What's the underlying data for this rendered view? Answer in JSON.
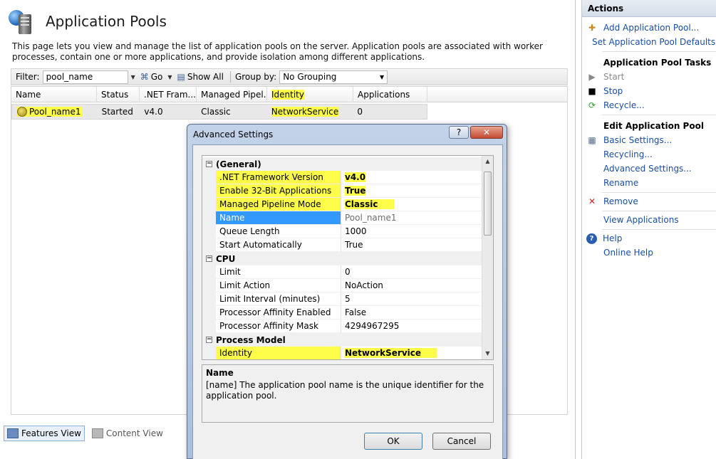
{
  "page": {
    "title": "Application Pools",
    "description": "This page lets you view and manage the list of application pools on the server. Application pools are associated with worker processes, contain one or more applications, and provide isolation among different applications."
  },
  "filter_bar": {
    "filter_label": "Filter:",
    "filter_value": "pool_name",
    "go_label": "Go",
    "show_all_label": "Show All",
    "group_by_label": "Group by:",
    "group_by_value": "No Grouping"
  },
  "grid": {
    "columns": [
      "Name",
      "Status",
      ".NET Fram...",
      "Managed Pipel...",
      "Identity",
      "Applications"
    ],
    "rows": [
      {
        "name": "Pool_name1",
        "status": "Started",
        "net": "v4.0",
        "pipeline": "Classic",
        "identity": "NetworkService",
        "applications": "0"
      }
    ]
  },
  "view_tabs": {
    "features": "Features View",
    "content": "Content View"
  },
  "actions": {
    "title": "Actions",
    "add_pool": "Add Application Pool...",
    "set_defaults": "Set Application Pool Defaults...",
    "tasks_header": "Application Pool Tasks",
    "start": "Start",
    "stop": "Stop",
    "recycle": "Recycle...",
    "edit_header": "Edit Application Pool",
    "basic_settings": "Basic Settings...",
    "recycling": "Recycling...",
    "advanced_settings": "Advanced Settings...",
    "rename": "Rename",
    "remove": "Remove",
    "view_applications": "View Applications",
    "help": "Help",
    "online_help": "Online Help"
  },
  "dialog": {
    "title": "Advanced Settings",
    "help_btn": "?",
    "close_btn": "✕",
    "categories": {
      "general": "(General)",
      "cpu": "CPU",
      "process_model": "Process Model"
    },
    "props": {
      "net_version": {
        "name": ".NET Framework Version",
        "value": "v4.0"
      },
      "enable32": {
        "name": "Enable 32-Bit Applications",
        "value": "True"
      },
      "pipeline": {
        "name": "Managed Pipeline Mode",
        "value": "Classic"
      },
      "name": {
        "name": "Name",
        "value": "Pool_name1"
      },
      "queue_length": {
        "name": "Queue Length",
        "value": "1000"
      },
      "start_auto": {
        "name": "Start Automatically",
        "value": "True"
      },
      "limit": {
        "name": "Limit",
        "value": "0"
      },
      "limit_action": {
        "name": "Limit Action",
        "value": "NoAction"
      },
      "limit_interval": {
        "name": "Limit Interval (minutes)",
        "value": "5"
      },
      "affinity_enabled": {
        "name": "Processor Affinity Enabled",
        "value": "False"
      },
      "affinity_mask": {
        "name": "Processor Affinity Mask",
        "value": "4294967295"
      },
      "identity": {
        "name": "Identity",
        "value": "NetworkService"
      }
    },
    "description": {
      "title": "Name",
      "text": "[name] The application pool name is the unique identifier for the application pool."
    },
    "ok": "OK",
    "cancel": "Cancel"
  },
  "colors": {
    "highlight": "#fdfd4a",
    "link": "#1a4ea3",
    "selection": "#3399ff"
  }
}
